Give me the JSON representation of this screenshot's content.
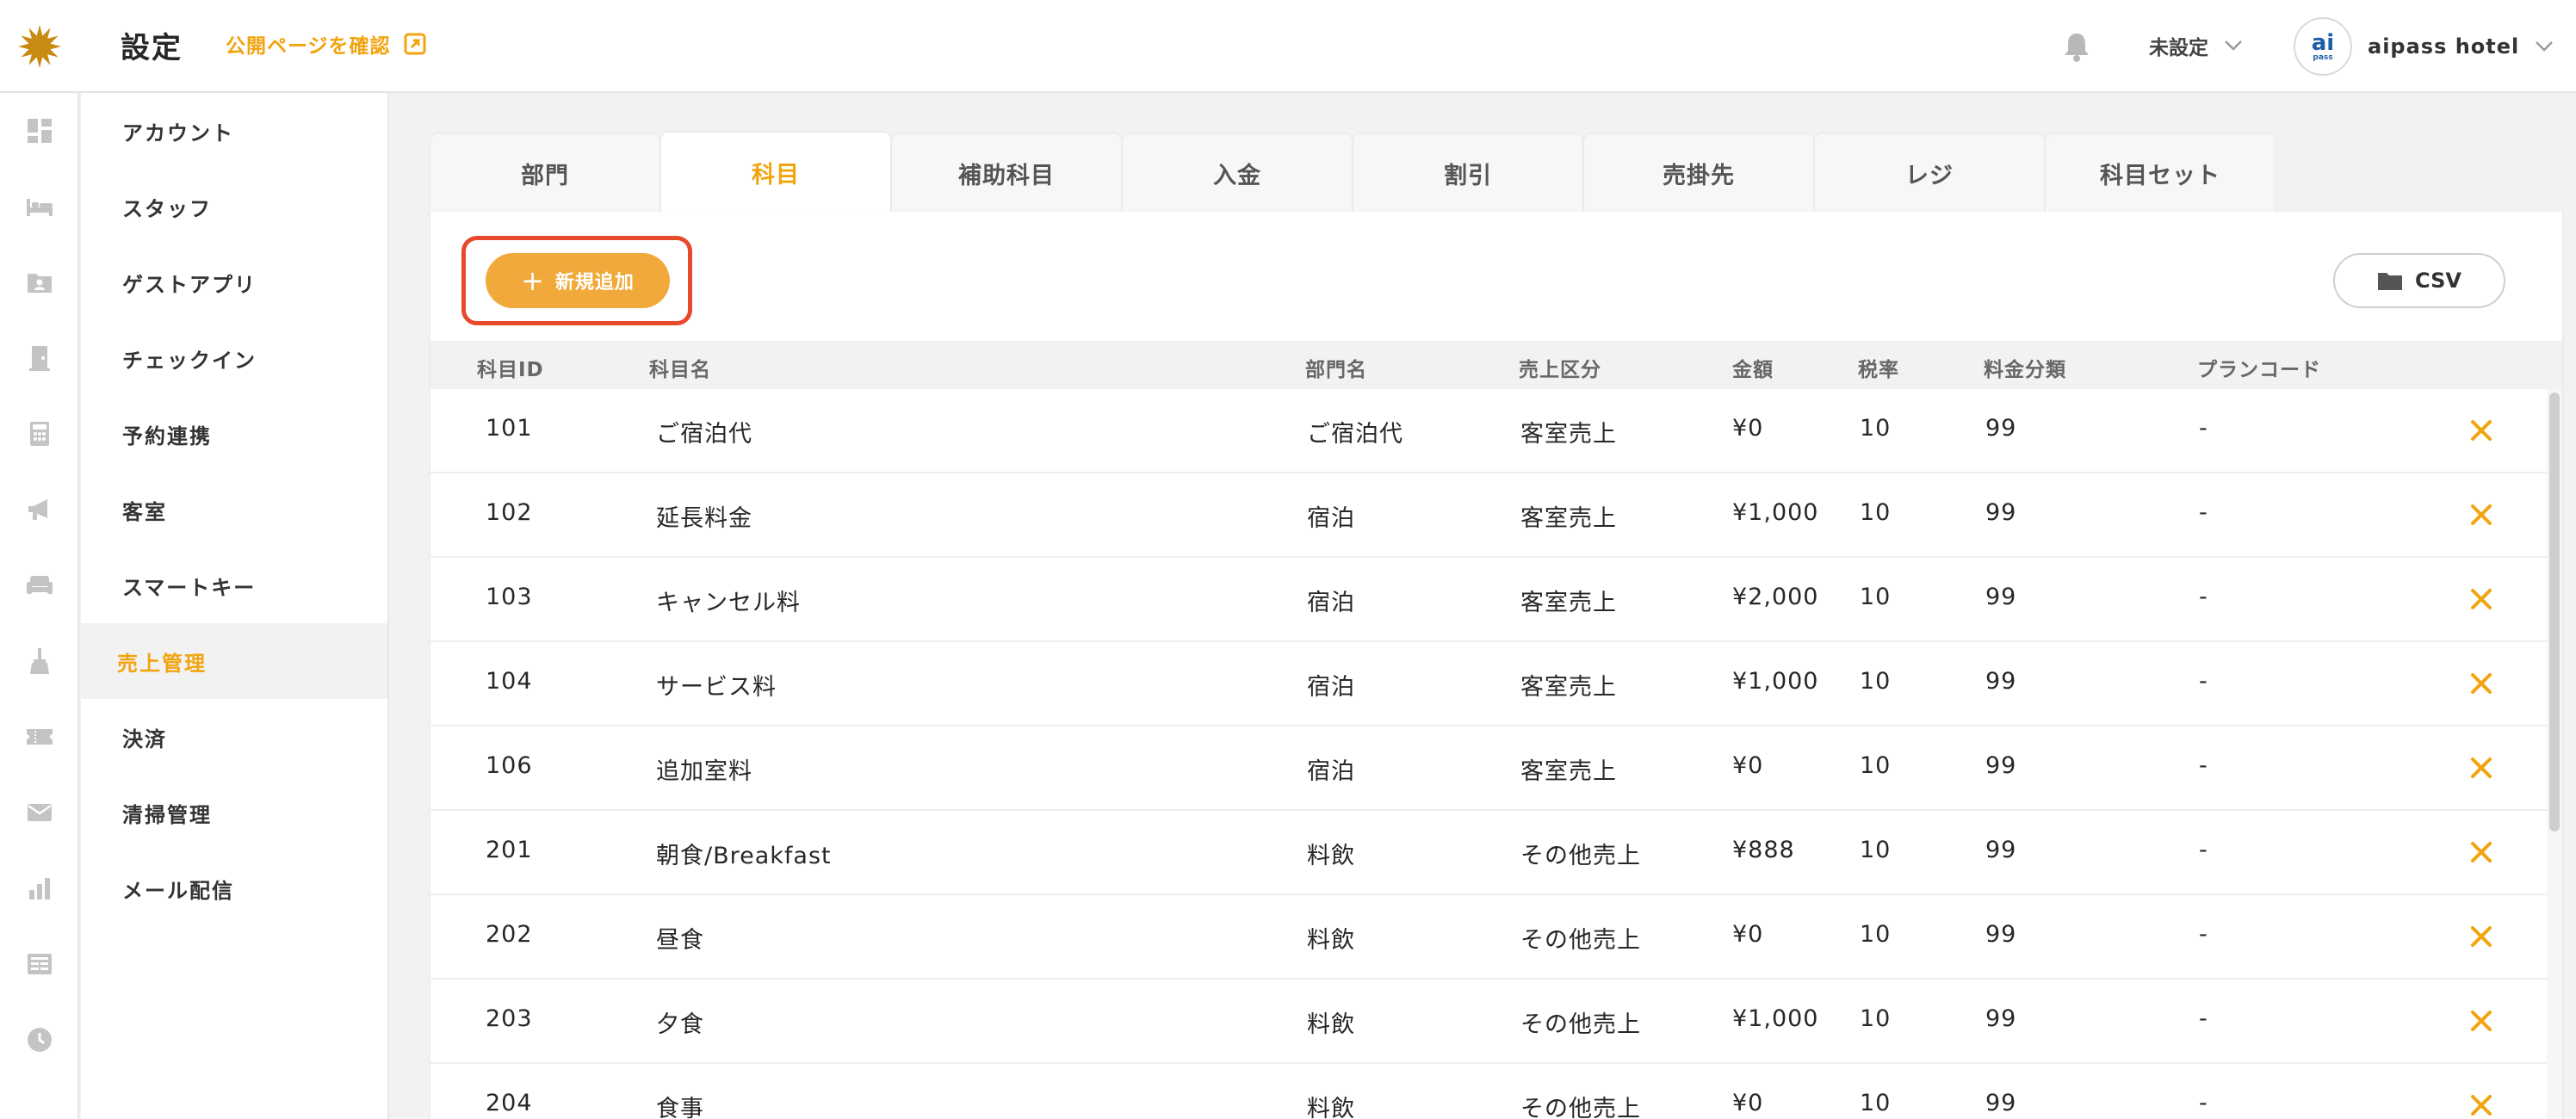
{
  "header": {
    "title": "設定",
    "public_link": "公開ページを確認",
    "language": "未設定",
    "account_name": "aipass hotel",
    "avatar_text": "ai",
    "avatar_sub": "pass"
  },
  "rail": {
    "icons": [
      "dashboard-icon",
      "bed-icon",
      "folder-person-icon",
      "door-icon",
      "calculator-icon",
      "megaphone-icon",
      "sofa-icon",
      "broom-icon",
      "ticket-icon",
      "mail-icon",
      "bar-chart-icon",
      "news-icon",
      "clock-icon"
    ]
  },
  "sidebar": {
    "items": [
      {
        "label": "アカウント",
        "active": false
      },
      {
        "label": "スタッフ",
        "active": false
      },
      {
        "label": "ゲストアプリ",
        "active": false
      },
      {
        "label": "チェックイン",
        "active": false
      },
      {
        "label": "予約連携",
        "active": false
      },
      {
        "label": "客室",
        "active": false
      },
      {
        "label": "スマートキー",
        "active": false
      },
      {
        "label": "売上管理",
        "active": true
      },
      {
        "label": "決済",
        "active": false
      },
      {
        "label": "清掃管理",
        "active": false
      },
      {
        "label": "メール配信",
        "active": false
      }
    ]
  },
  "tabs": [
    {
      "label": "部門",
      "active": false
    },
    {
      "label": "科目",
      "active": true
    },
    {
      "label": "補助科目",
      "active": false
    },
    {
      "label": "入金",
      "active": false
    },
    {
      "label": "割引",
      "active": false
    },
    {
      "label": "売掛先",
      "active": false
    },
    {
      "label": "レジ",
      "active": false
    },
    {
      "label": "科目セット",
      "active": false
    }
  ],
  "toolbar": {
    "add_label": "新規追加",
    "csv_label": "CSV"
  },
  "colors": {
    "accent": "#f2a40e",
    "button": "#f2a93b",
    "highlight": "#e64a2b"
  },
  "table": {
    "columns": [
      "科目ID",
      "科目名",
      "部門名",
      "売上区分",
      "金額",
      "税率",
      "料金分類",
      "プランコード"
    ],
    "rows": [
      [
        "101",
        "ご宿泊代",
        "ご宿泊代",
        "客室売上",
        "¥0",
        "10",
        "99",
        "-"
      ],
      [
        "102",
        "延長料金",
        "宿泊",
        "客室売上",
        "¥1,000",
        "10",
        "99",
        "-"
      ],
      [
        "103",
        "キャンセル料",
        "宿泊",
        "客室売上",
        "¥2,000",
        "10",
        "99",
        "-"
      ],
      [
        "104",
        "サービス料",
        "宿泊",
        "客室売上",
        "¥1,000",
        "10",
        "99",
        "-"
      ],
      [
        "106",
        "追加室料",
        "宿泊",
        "客室売上",
        "¥0",
        "10",
        "99",
        "-"
      ],
      [
        "201",
        "朝食/Breakfast",
        "料飲",
        "その他売上",
        "¥888",
        "10",
        "99",
        "-"
      ],
      [
        "202",
        "昼食",
        "料飲",
        "その他売上",
        "¥0",
        "10",
        "99",
        "-"
      ],
      [
        "203",
        "夕食",
        "料飲",
        "その他売上",
        "¥1,000",
        "10",
        "99",
        "-"
      ],
      [
        "204",
        "食事",
        "料飲",
        "その他売上",
        "¥0",
        "10",
        "99",
        "-"
      ]
    ]
  }
}
